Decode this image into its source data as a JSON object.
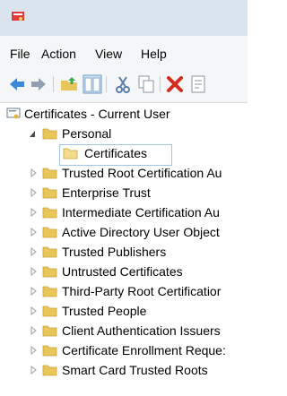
{
  "menu": [
    "File",
    "Action",
    "View",
    "Help"
  ],
  "tree": {
    "root_label": "Certificates - Current User",
    "personal_label": "Personal",
    "certificates_label": "Certificates",
    "stores": [
      "Trusted Root Certification Au",
      "Enterprise Trust",
      "Intermediate Certification Au",
      "Active Directory User Object",
      "Trusted Publishers",
      "Untrusted Certificates",
      "Third-Party Root Certificatior",
      "Trusted People",
      "Client Authentication Issuers",
      "Certificate Enrollment Reque:",
      "Smart Card Trusted Roots"
    ]
  },
  "colors": {
    "folder": "#e8c65a",
    "accent": "#3d87d9",
    "delete": "#d62b1f"
  }
}
